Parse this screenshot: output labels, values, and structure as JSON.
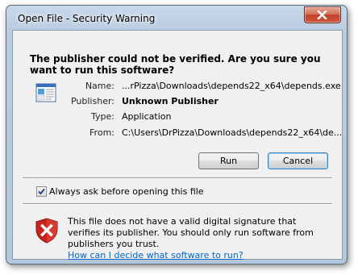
{
  "window": {
    "title": "Open File - Security Warning"
  },
  "headline": "The publisher could not be verified.  Are you sure you want to run this software?",
  "details": [
    {
      "label": "Name:",
      "value": "...rPizza\\Downloads\\depends22_x64\\depends.exe",
      "bold": false
    },
    {
      "label": "Publisher:",
      "value": "Unknown Publisher",
      "bold": true
    },
    {
      "label": "Type:",
      "value": "Application",
      "bold": false
    },
    {
      "label": "From:",
      "value": "C:\\Users\\DrPizza\\Downloads\\depends22_x64\\de...",
      "bold": false
    }
  ],
  "buttons": {
    "run": "Run",
    "cancel": "Cancel"
  },
  "checkbox": {
    "label": "Always ask before opening this file",
    "checked": true
  },
  "warning": {
    "text": "This file does not have a valid digital signature that verifies its publisher.  You should only run software from publishers you trust.",
    "link": "How can I decide what software to run?"
  },
  "icons": {
    "close": "close-icon",
    "app": "application-icon",
    "shield": "shield-warning-icon",
    "check": "checkmark-icon"
  },
  "colors": {
    "title_bar": "#b9cce0",
    "close_button": "#c0402a",
    "link": "#0066cc",
    "shield_red": "#c8231c"
  }
}
